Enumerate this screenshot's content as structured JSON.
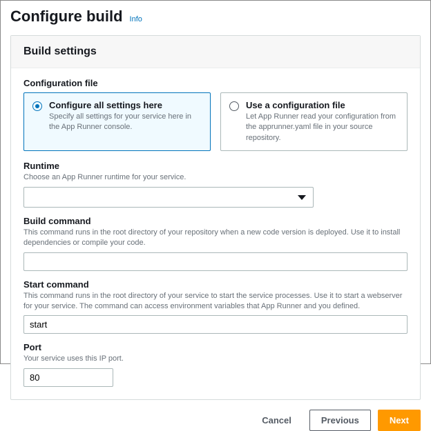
{
  "header": {
    "title": "Configure build",
    "info": "Info"
  },
  "panel": {
    "title": "Build settings"
  },
  "config_file": {
    "label": "Configuration file",
    "options": [
      {
        "title": "Configure all settings here",
        "desc": "Specify all settings for your service here in the App Runner console.",
        "selected": true
      },
      {
        "title": "Use a configuration file",
        "desc": "Let App Runner read your configuration from the apprunner.yaml file in your source repository.",
        "selected": false
      }
    ]
  },
  "runtime": {
    "label": "Runtime",
    "desc": "Choose an App Runner runtime for your service.",
    "value": ""
  },
  "build_cmd": {
    "label": "Build command",
    "desc": "This command runs in the root directory of your repository when a new code version is deployed. Use it to install dependencies or compile your code.",
    "value": ""
  },
  "start_cmd": {
    "label": "Start command",
    "desc": "This command runs in the root directory of your service to start the service processes. Use it to start a webserver for your service. The command can access environment variables that App Runner and you defined.",
    "value": "start"
  },
  "port": {
    "label": "Port",
    "desc": "Your service uses this IP port.",
    "value": "80"
  },
  "footer": {
    "cancel": "Cancel",
    "previous": "Previous",
    "next": "Next"
  }
}
